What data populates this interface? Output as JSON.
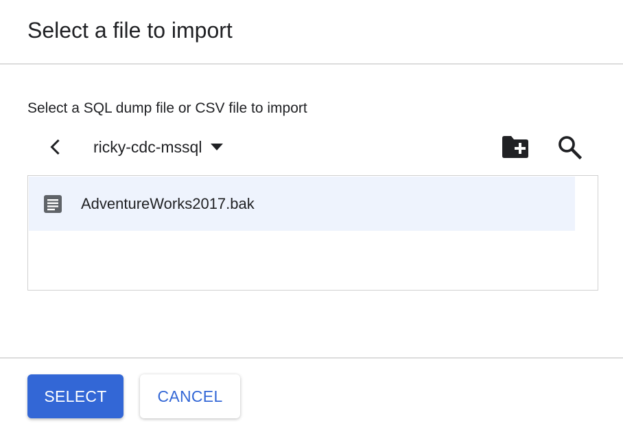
{
  "dialog": {
    "title": "Select a file to import",
    "instruction": "Select a SQL dump file or CSV file to import"
  },
  "toolbar": {
    "back_icon": "chevron-left-icon",
    "bucket_name": "ricky-cdc-mssql",
    "dropdown_icon": "caret-down-icon",
    "new_folder_icon": "create-new-folder-icon",
    "search_icon": "search-icon"
  },
  "files": [
    {
      "name": "AdventureWorks2017.bak",
      "icon": "document-icon",
      "selected": true
    }
  ],
  "footer": {
    "select_label": "SELECT",
    "cancel_label": "CANCEL"
  },
  "colors": {
    "primary": "#3367d6",
    "selected_row": "#eef3fd",
    "divider": "#dcdcdc"
  }
}
